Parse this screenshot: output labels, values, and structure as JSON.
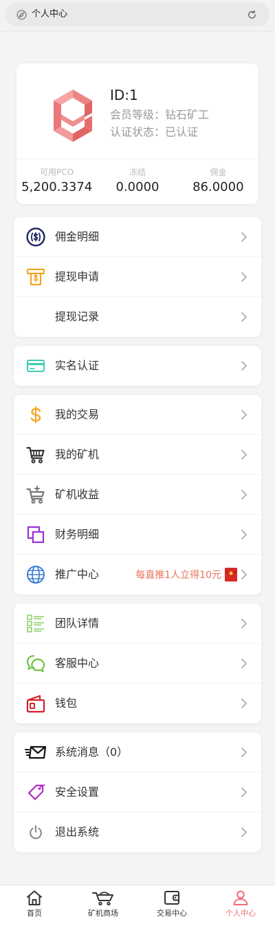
{
  "top_bar": {
    "title": "个人中心",
    "left_icon": "leaf-icon",
    "right_icon": "refresh-icon"
  },
  "profile": {
    "logo_icon": "logo-icon",
    "id_text": "ID:1",
    "level_text": "会员等级：钻石矿工",
    "status_text": "认证状态：已认证",
    "stats": [
      {
        "label": "可用PCO",
        "value": "5,200.3374"
      },
      {
        "label": "冻结",
        "value": "0.0000"
      },
      {
        "label": "佣金",
        "value": "86.0000"
      }
    ]
  },
  "menu": {
    "chevron_icon": "chevron-right-icon",
    "groups": [
      {
        "items": [
          {
            "label": "佣金明细",
            "icon": "dollar-circle-icon",
            "icon_color": "#1c2462"
          },
          {
            "label": "提现申请",
            "icon": "atm-withdraw-icon",
            "icon_color": "#f5a623"
          },
          {
            "label": "提现记录"
          }
        ]
      },
      {
        "items": [
          {
            "label": "实名认证",
            "icon": "id-card-icon",
            "icon_color": "#3ccfb4"
          }
        ]
      },
      {
        "items": [
          {
            "label": "我的交易",
            "icon": "dollar-icon",
            "icon_color": "#f5a623"
          },
          {
            "label": "我的矿机",
            "icon": "cart-icon",
            "icon_color": "#333333"
          },
          {
            "label": "矿机收益",
            "icon": "cart-plus-icon",
            "icon_color": "#777777"
          },
          {
            "label": "财务明细",
            "icon": "finance-squares-icon",
            "icon_color": "#9b2fd6"
          },
          {
            "label": "推广中心",
            "icon": "globe-icon",
            "icon_color": "#3d7fd8",
            "promo_text": "每直推1人立得10元",
            "promo_icon": "red-envelope-icon"
          }
        ]
      },
      {
        "items": [
          {
            "label": "团队详情",
            "icon": "list-icon",
            "icon_color": "#9bd77a"
          },
          {
            "label": "客服中心",
            "icon": "chat-icon",
            "icon_color": "#6cc644"
          },
          {
            "label": "钱包",
            "icon": "wallet-icon",
            "icon_color": "#d4202c"
          }
        ]
      },
      {
        "items": [
          {
            "label": "系统消息（0）",
            "icon": "message-envelope-icon",
            "icon_color": "#111111"
          },
          {
            "label": "安全设置",
            "icon": "tag-icon",
            "icon_color": "#b12bc4"
          },
          {
            "label": "退出系统",
            "icon": "power-icon",
            "icon_color": "#888888"
          }
        ]
      }
    ]
  },
  "bottom_nav": {
    "items": [
      {
        "label": "首页",
        "icon": "home-icon",
        "active": false
      },
      {
        "label": "矿机商场",
        "icon": "mining-shop-icon",
        "active": false
      },
      {
        "label": "交易中心",
        "icon": "wallet-outline-icon",
        "active": false
      },
      {
        "label": "个人中心",
        "icon": "user-icon",
        "active": true
      }
    ]
  },
  "colors": {
    "page_bg": "#f4f4f4",
    "card_bg": "#ffffff",
    "text_primary": "#333333",
    "text_muted": "#999999",
    "promo": "#e8735a",
    "nav_active": "#f06a7a",
    "logo": "#ee8080"
  }
}
